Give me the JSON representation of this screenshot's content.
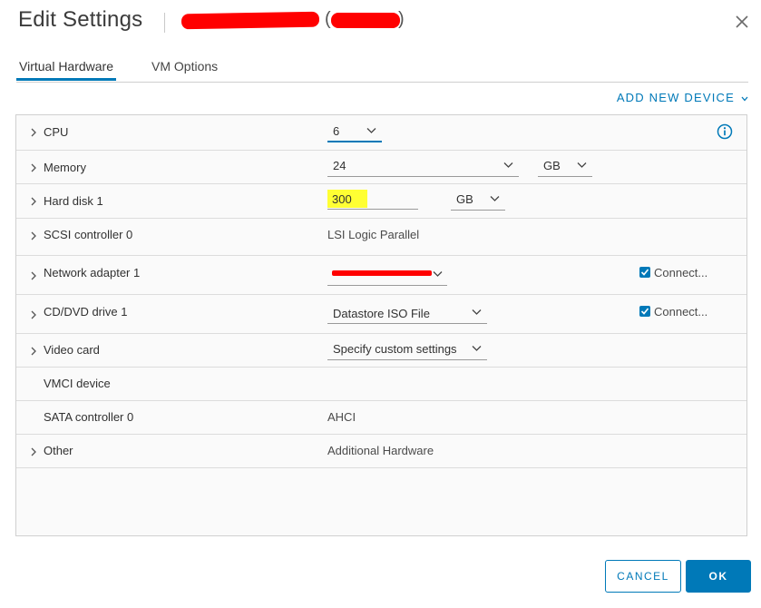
{
  "dialog": {
    "title": "Edit Settings",
    "vm_name_open_paren": "(",
    "vm_name_close_paren": ")"
  },
  "tabs": [
    {
      "label": "Virtual Hardware",
      "active": true
    },
    {
      "label": "VM Options",
      "active": false
    }
  ],
  "add_device_label": "ADD NEW DEVICE",
  "hardware": {
    "cpu": {
      "label": "CPU",
      "value": "6"
    },
    "memory": {
      "label": "Memory",
      "value": "24",
      "unit": "GB"
    },
    "hard_disk": {
      "label": "Hard disk 1",
      "value": "300",
      "unit": "GB"
    },
    "scsi": {
      "label": "SCSI controller 0",
      "value": "LSI Logic Parallel"
    },
    "network": {
      "label": "Network adapter 1",
      "connect_label": "Connect..."
    },
    "cdvd": {
      "label": "CD/DVD drive 1",
      "value": "Datastore ISO File",
      "connect_label": "Connect..."
    },
    "video": {
      "label": "Video card",
      "value": "Specify custom settings"
    },
    "vmci": {
      "label": "VMCI device"
    },
    "sata": {
      "label": "SATA controller 0",
      "value": "AHCI"
    },
    "other": {
      "label": "Other",
      "value": "Additional Hardware"
    }
  },
  "buttons": {
    "cancel": "CANCEL",
    "ok": "OK"
  },
  "colors": {
    "accent": "#0079b8",
    "highlight": "#ffff33",
    "redaction": "#ff0000"
  },
  "icons": {
    "close": "close-icon",
    "info": "info-icon",
    "expand": "chevron-right-icon",
    "dropdown": "chevron-down-icon",
    "checkbox": "checkmark-icon"
  }
}
